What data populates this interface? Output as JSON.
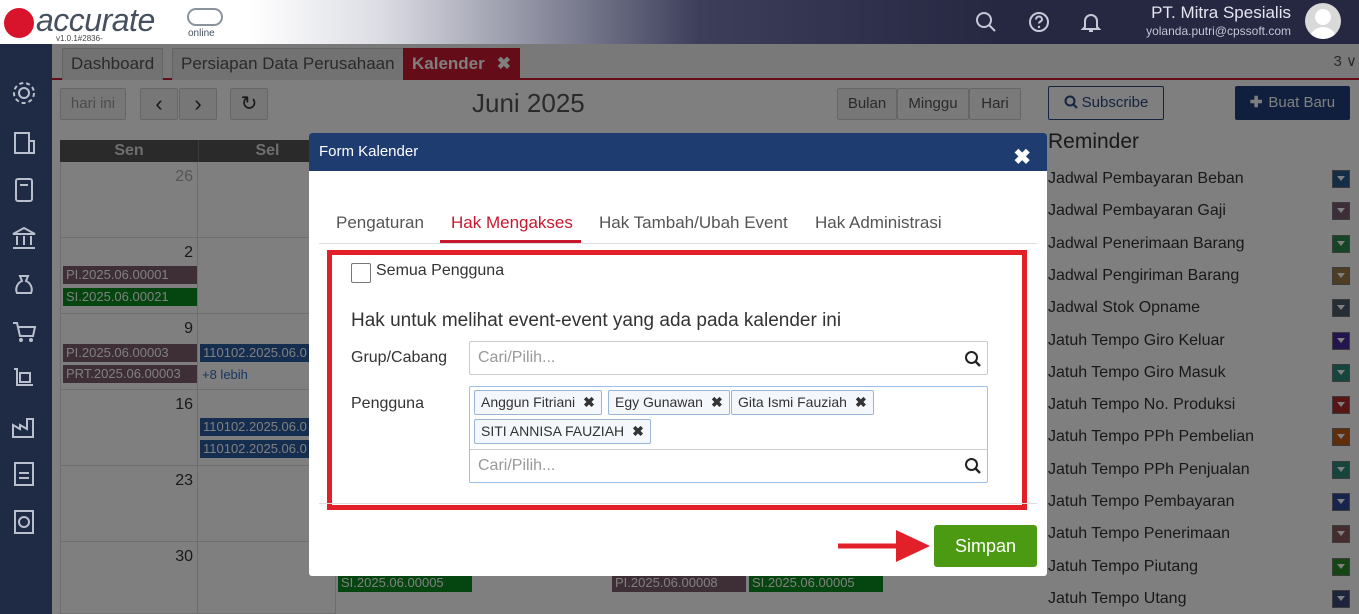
{
  "app": {
    "logo_text": "accurate",
    "logo_sub": "online",
    "version": "v1.0.1#2836-1680003",
    "company": "PT. Mitra Spesialis",
    "user_email": "yolanda.putri@cpssoft.com"
  },
  "tabs": {
    "items": [
      {
        "label": "Dashboard"
      },
      {
        "label": "Persiapan Data Perusahaan"
      },
      {
        "label": "Kalender",
        "close": "✖"
      }
    ],
    "count": "3 ∨"
  },
  "calendar": {
    "today_label": "hari ini",
    "prev": "‹",
    "next": "›",
    "refresh": "↻",
    "month_title": "Juni 2025",
    "views": [
      "Bulan",
      "Minggu",
      "Hari"
    ],
    "day_headers": [
      "Sen",
      "Sel"
    ],
    "days": {
      "d26": "26",
      "d2": "2",
      "d9": "9",
      "d16": "16",
      "d23": "23",
      "d30": "30"
    },
    "events": {
      "e1": "PI.2025.06.00001",
      "e2": "SI.2025.06.00021",
      "e3": "PI.2025.06.00003",
      "e4": "PRT.2025.06.00003",
      "e5": "110102.2025.06.0",
      "e6": "110102.2025.06.0",
      "e7": "110102.2025.06.0",
      "e8": "SI.2025.06.00005",
      "e9": "PI.2025.06.00008",
      "e10": "SI.2025.06.00005"
    },
    "more": "+8 lebih"
  },
  "right": {
    "subscribe": "Subscribe",
    "buat_baru": "Buat Baru",
    "reminder_title": "Reminder",
    "reminders": [
      {
        "label": "Jadwal Pembayaran Beban",
        "color": "#2a5a8a"
      },
      {
        "label": "Jadwal Pembayaran Gaji",
        "color": "#7a5a72"
      },
      {
        "label": "Jadwal Penerimaan Barang",
        "color": "#2a8a4a"
      },
      {
        "label": "Jadwal Pengiriman Barang",
        "color": "#9a7a4a"
      },
      {
        "label": "Jadwal Stok Opname",
        "color": "#4a5a6a"
      },
      {
        "label": "Jatuh Tempo Giro Keluar",
        "color": "#4a2a9a"
      },
      {
        "label": "Jatuh Tempo Giro Masuk",
        "color": "#2a8a7a"
      },
      {
        "label": "Jatuh Tempo No. Produksi",
        "color": "#b02a2a"
      },
      {
        "label": "Jatuh Tempo PPh Pembelian",
        "color": "#c05a1a"
      },
      {
        "label": "Jatuh Tempo PPh Penjualan",
        "color": "#2a8a7a"
      },
      {
        "label": "Jatuh Tempo Pembayaran",
        "color": "#2a4a9a"
      },
      {
        "label": "Jatuh Tempo Penerimaan",
        "color": "#8a5a5a"
      },
      {
        "label": "Jatuh Tempo Piutang",
        "color": "#2a8a2a"
      },
      {
        "label": "Jatuh Tempo Utang",
        "color": "#3a4a7a"
      }
    ]
  },
  "modal": {
    "title": "Form Kalender",
    "close": "✖",
    "tabs": [
      "Pengaturan",
      "Hak Mengakses",
      "Hak Tambah/Ubah Event",
      "Hak Administrasi"
    ],
    "semua_pengguna": "Semua Pengguna",
    "section_title": "Hak untuk melihat event-event yang ada pada kalender ini",
    "grup_label": "Grup/Cabang",
    "grup_placeholder": "Cari/Pilih...",
    "pengguna_label": "Pengguna",
    "pengguna_placeholder": "Cari/Pilih...",
    "chips": [
      "Anggun Fitriani",
      "Egy Gunawan",
      "Gita Ismi Fauziah",
      "SITI ANNISA FAUZIAH"
    ],
    "chip_remove": "✖",
    "simpan": "Simpan"
  },
  "colors": {
    "accent_red": "#c8182e",
    "highlight_red": "#e2202a",
    "modal_header": "#1e3c70",
    "save_green": "#4c9a12"
  }
}
